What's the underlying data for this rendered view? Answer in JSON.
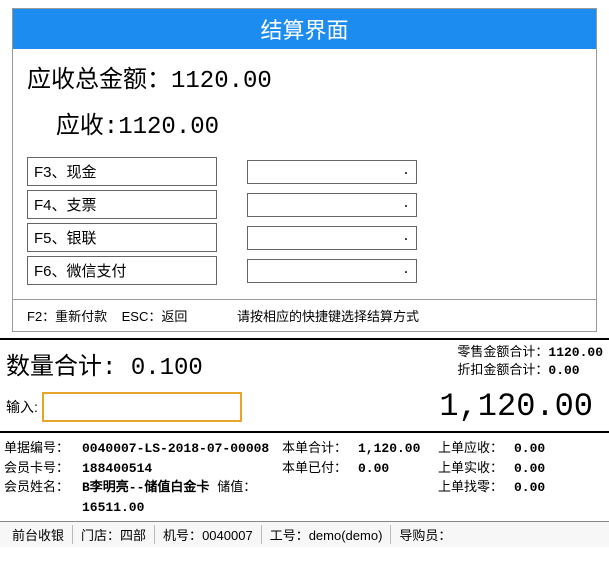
{
  "dialog": {
    "title": "结算界面",
    "total_label": "应收总金额：",
    "total_value": "1120.00",
    "due_label": "应收:",
    "due_value": "1120.00",
    "methods": [
      {
        "label": "F3、现金",
        "value": "."
      },
      {
        "label": "F4、支票",
        "value": "."
      },
      {
        "label": "F5、银联",
        "value": "."
      },
      {
        "label": "F6、微信支付",
        "value": "."
      }
    ],
    "hint_left_a": "F2：重新付款",
    "hint_left_b": "ESC：返回",
    "hint_right": "请按相应的快捷键选择结算方式"
  },
  "summary": {
    "qty_label": "数量合计:",
    "qty_value": "0.100",
    "retail_label": "零售金额合计：",
    "retail_value": "1120.00",
    "discount_label": "折扣金额合计：",
    "discount_value": "0.00"
  },
  "input": {
    "label": "输入:",
    "big_amount": "1,120.00"
  },
  "info": {
    "doc_no_label": "单据编号：",
    "doc_no": "0040007-LS-2018-07-00008",
    "card_no_label": "会员卡号：",
    "card_no": "188400514",
    "name_label": "会员姓名：",
    "name": "B李明亮--储值白金卡",
    "this_total_label": "本单合计：",
    "this_total": "1,120.00",
    "this_paid_label": "本单已付：",
    "this_paid": "0.00",
    "stored_label": "储值：",
    "stored": "16511.00",
    "prev_due_label": "上单应收：",
    "prev_due": "0.00",
    "prev_recv_label": "上单实收：",
    "prev_recv": "0.00",
    "prev_change_label": "上单找零：",
    "prev_change": "0.00"
  },
  "status": {
    "pos_label": "前台收银",
    "store_label": "门店：",
    "store": "四部",
    "machine_label": "机号：",
    "machine": "0040007",
    "emp_label": "工号：",
    "emp": "demo(demo)",
    "guide_label": "导购员："
  }
}
